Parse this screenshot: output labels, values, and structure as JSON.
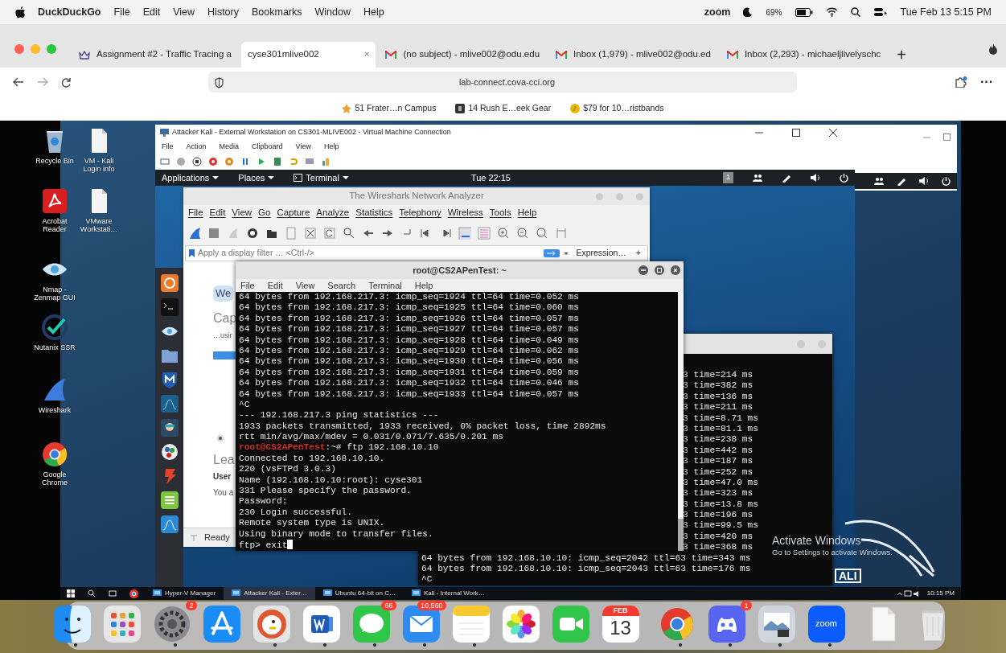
{
  "menubar": {
    "app": "DuckDuckGo",
    "menus": [
      "File",
      "Edit",
      "View",
      "History",
      "Bookmarks",
      "Window",
      "Help"
    ],
    "zoom": "zoom",
    "battery": "69%",
    "clock": "Tue Feb 13  5:15 PM"
  },
  "browser": {
    "tabs": [
      {
        "title": "Assignment #2 - Traffic Tracing a",
        "selected": false,
        "kind": "crown"
      },
      {
        "title": "cyse301mlive002",
        "selected": true,
        "kind": "plain",
        "close": "×"
      },
      {
        "title": "(no subject) - mlive002@odu.edu",
        "selected": false,
        "kind": "mail"
      },
      {
        "title": "Inbox (1,979) - mlive002@odu.ed",
        "selected": false,
        "kind": "mail"
      },
      {
        "title": "Inbox (2,293) - michaeljlivelyschc",
        "selected": false,
        "kind": "mail"
      }
    ],
    "new_tab": "+",
    "address": "lab-connect.cova-cci.org",
    "more": "···",
    "bookmarks": [
      {
        "title": "51 Frater…n Campus"
      },
      {
        "title": "14 Rush E…eek Gear"
      },
      {
        "title": "$79 for 10…ristbands"
      }
    ]
  },
  "desktop_icons": [
    {
      "label": "Recycle Bin"
    },
    {
      "label": "VM - Kali Login info"
    },
    {
      "label": "Acrobat Reader"
    },
    {
      "label": "VMware Workstati…"
    },
    {
      "label": "Nmap - Zenmap GUI"
    },
    {
      "label": "Nutanix SSR"
    },
    {
      "label": "Wireshark"
    },
    {
      "label": "Google Chrome"
    }
  ],
  "vm_window": {
    "title": "Attacker Kali - External Workstation on CS301-MLIVE002 - Virtual Machine Connection",
    "menus": [
      "File",
      "Action",
      "Media",
      "Clipboard",
      "View",
      "Help"
    ],
    "kali_bar": {
      "menus": [
        "Applications",
        "Places",
        "Terminal"
      ],
      "clock": "Tue 22:15",
      "workspace": "1"
    }
  },
  "wireshark": {
    "title": "The Wireshark Network Analyzer",
    "menus": [
      "File",
      "Edit",
      "View",
      "Go",
      "Capture",
      "Analyze",
      "Statistics",
      "Telephony",
      "Wireless",
      "Tools",
      "Help"
    ],
    "filter_placeholder": "Apply a display filter … <Ctrl-/>",
    "expression": "Expression…",
    "add": "+",
    "welcome": {
      "button": "We",
      "heading": "Cap",
      "subtitle": "…usir",
      "learn": "Lea",
      "user": "User",
      "you": "You a"
    },
    "status": "Ready"
  },
  "front_terminal": {
    "title": "root@CS2APenTest: ~",
    "menus": [
      "File",
      "Edit",
      "View",
      "Search",
      "Terminal",
      "Help"
    ],
    "lines": [
      {
        "kind": "out",
        "text": "64 bytes from 192.168.217.3: icmp_seq=1924 ttl=64 time=0.052 ms"
      },
      {
        "kind": "out",
        "text": "64 bytes from 192.168.217.3: icmp_seq=1925 ttl=64 time=0.060 ms"
      },
      {
        "kind": "out",
        "text": "64 bytes from 192.168.217.3: icmp_seq=1926 ttl=64 time=0.057 ms"
      },
      {
        "kind": "out",
        "text": "64 bytes from 192.168.217.3: icmp_seq=1927 ttl=64 time=0.057 ms"
      },
      {
        "kind": "out",
        "text": "64 bytes from 192.168.217.3: icmp_seq=1928 ttl=64 time=0.049 ms"
      },
      {
        "kind": "out",
        "text": "64 bytes from 192.168.217.3: icmp_seq=1929 ttl=64 time=0.062 ms"
      },
      {
        "kind": "out",
        "text": "64 bytes from 192.168.217.3: icmp_seq=1930 ttl=64 time=0.056 ms"
      },
      {
        "kind": "out",
        "text": "64 bytes from 192.168.217.3: icmp_seq=1931 ttl=64 time=0.059 ms"
      },
      {
        "kind": "out",
        "text": "64 bytes from 192.168.217.3: icmp_seq=1932 ttl=64 time=0.046 ms"
      },
      {
        "kind": "out",
        "text": "64 bytes from 192.168.217.3: icmp_seq=1933 ttl=64 time=0.057 ms"
      },
      {
        "kind": "out",
        "text": "^C"
      },
      {
        "kind": "out",
        "text": "--- 192.168.217.3 ping statistics ---"
      },
      {
        "kind": "out",
        "text": "1933 packets transmitted, 1933 received, 0% packet loss, time 2892ms"
      },
      {
        "kind": "out",
        "text": "rtt min/avg/max/mdev = 0.031/0.071/7.635/0.201 ms"
      },
      {
        "kind": "prompt",
        "user": "root@CS2APenTest",
        "text": ":~# ftp 192.168.10.10"
      },
      {
        "kind": "out",
        "text": "Connected to 192.168.10.10."
      },
      {
        "kind": "out",
        "text": "220 (vsFTPd 3.0.3)"
      },
      {
        "kind": "out",
        "text": "Name (192.168.10.10:root): cyse301"
      },
      {
        "kind": "out",
        "text": "331 Please specify the password."
      },
      {
        "kind": "out",
        "text": "Password:"
      },
      {
        "kind": "out",
        "text": "230 Login successful."
      },
      {
        "kind": "out",
        "text": "Remote system type is UNIX."
      },
      {
        "kind": "out",
        "text": "Using binary mode to transfer files."
      },
      {
        "kind": "input",
        "text": "ftp> exit"
      }
    ]
  },
  "back_terminal": {
    "lines": [
      {
        "kind": "tail",
        "text": "3 time=214 ms"
      },
      {
        "kind": "tail",
        "text": "3 time=382 ms"
      },
      {
        "kind": "tail",
        "text": "3 time=136 ms"
      },
      {
        "kind": "tail",
        "text": "3 time=211 ms"
      },
      {
        "kind": "tail",
        "text": "3 time=8.71 ms"
      },
      {
        "kind": "tail",
        "text": "3 time=81.1 ms"
      },
      {
        "kind": "tail",
        "text": "3 time=238 ms"
      },
      {
        "kind": "tail",
        "text": "3 time=442 ms"
      },
      {
        "kind": "tail",
        "text": "3 time=187 ms"
      },
      {
        "kind": "tail",
        "text": "3 time=252 ms"
      },
      {
        "kind": "tail",
        "text": "3 time=47.0 ms"
      },
      {
        "kind": "tail",
        "text": "3 time=323 ms"
      },
      {
        "kind": "tail",
        "text": "3 time=13.8 ms"
      },
      {
        "kind": "tail",
        "text": "3 time=196 ms"
      },
      {
        "kind": "tail",
        "text": "3 time=99.5 ms"
      },
      {
        "kind": "tail",
        "text": "3 time=420 ms"
      },
      {
        "kind": "tail",
        "text": "3 time=368 ms"
      },
      {
        "kind": "full",
        "text": "64 bytes from 192.168.10.10: icmp_seq=2042 ttl=63 time=343 ms"
      },
      {
        "kind": "full",
        "text": "64 bytes from 192.168.10.10: icmp_seq=2043 ttl=63 time=176 ms"
      },
      {
        "kind": "full",
        "text": "^C"
      }
    ]
  },
  "kali_logo_text": "ALI",
  "activation": {
    "title": "Activate Windows",
    "hint": "Go to Settings to activate Windows."
  },
  "taskbar": {
    "items": [
      "Hyper-V Manager",
      "Attacker Kali - Exter…",
      "Ubuntu 64-bit on C…",
      "Kali - Internal Work…"
    ],
    "clock": "10:15 PM"
  },
  "dock": [
    {
      "kind": "app",
      "running": true
    },
    {
      "kind": "app",
      "running": false
    },
    {
      "kind": "app",
      "running": true,
      "badge": "2"
    },
    {
      "kind": "app",
      "running": false
    },
    {
      "kind": "app",
      "running": true
    },
    {
      "kind": "app",
      "running": true
    },
    {
      "kind": "app",
      "running": true,
      "badge": "66"
    },
    {
      "kind": "app",
      "running": true,
      "badge": "10,560"
    },
    {
      "kind": "app",
      "running": true
    },
    {
      "kind": "app",
      "running": false
    },
    {
      "kind": "app",
      "running": false
    },
    {
      "kind": "calendar",
      "running": false,
      "month": "FEB",
      "day": "13"
    },
    {
      "kind": "separator"
    },
    {
      "kind": "app",
      "running": true
    },
    {
      "kind": "app",
      "running": true,
      "badge": "1"
    },
    {
      "kind": "app",
      "running": true
    },
    {
      "kind": "zoom",
      "running": true,
      "label": "zoom"
    },
    {
      "kind": "separator"
    },
    {
      "kind": "app",
      "running": false
    },
    {
      "kind": "app",
      "running": false
    }
  ]
}
